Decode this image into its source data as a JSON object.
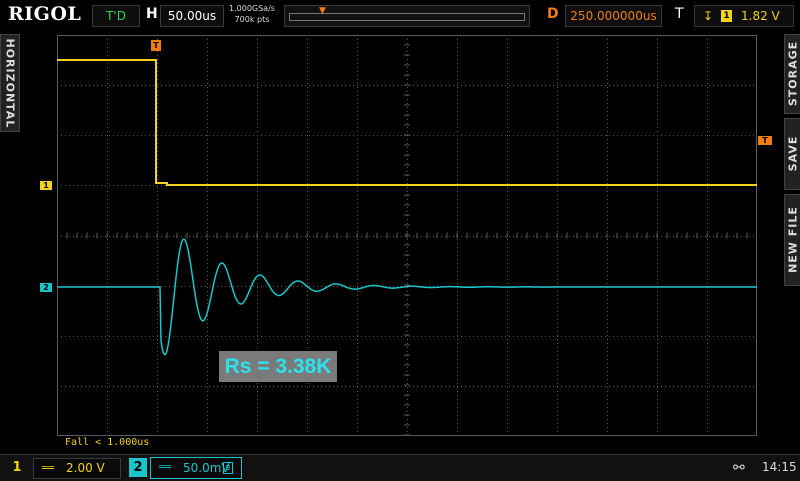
{
  "header": {
    "brand": "RIGOL",
    "run_state": "T'D",
    "h_label": "H",
    "timebase": "50.00us",
    "sample_rate": "1.000GSa/s",
    "memory_depth": "700k pts",
    "d_label": "D",
    "delay": "250.000000us",
    "t_label": "T",
    "trigger_source": "1",
    "trigger_level": "1.82 V"
  },
  "side_tabs": {
    "left": "HORIZONTAL",
    "right": [
      "STORAGE",
      "SAVE",
      "NEW FILE"
    ]
  },
  "markers": {
    "ch1": "1",
    "ch2": "2",
    "trigger": "T"
  },
  "annotation": "Rs = 3.38K",
  "trigger_status": "Fall < 1.000us",
  "channels": [
    {
      "num": "1",
      "coupling": "══",
      "scale": "2.00 V",
      "color": "#f2d21f"
    },
    {
      "num": "2",
      "coupling": "══",
      "scale": "50.0mV",
      "color": "#19c6cc"
    }
  ],
  "status": {
    "usb_icon": "usb-icon",
    "time": "14:15"
  },
  "colors": {
    "ch1": "#f2d21f",
    "ch2": "#19c6cc",
    "trigger": "#f07d12",
    "grid": "#5a5a5a"
  }
}
